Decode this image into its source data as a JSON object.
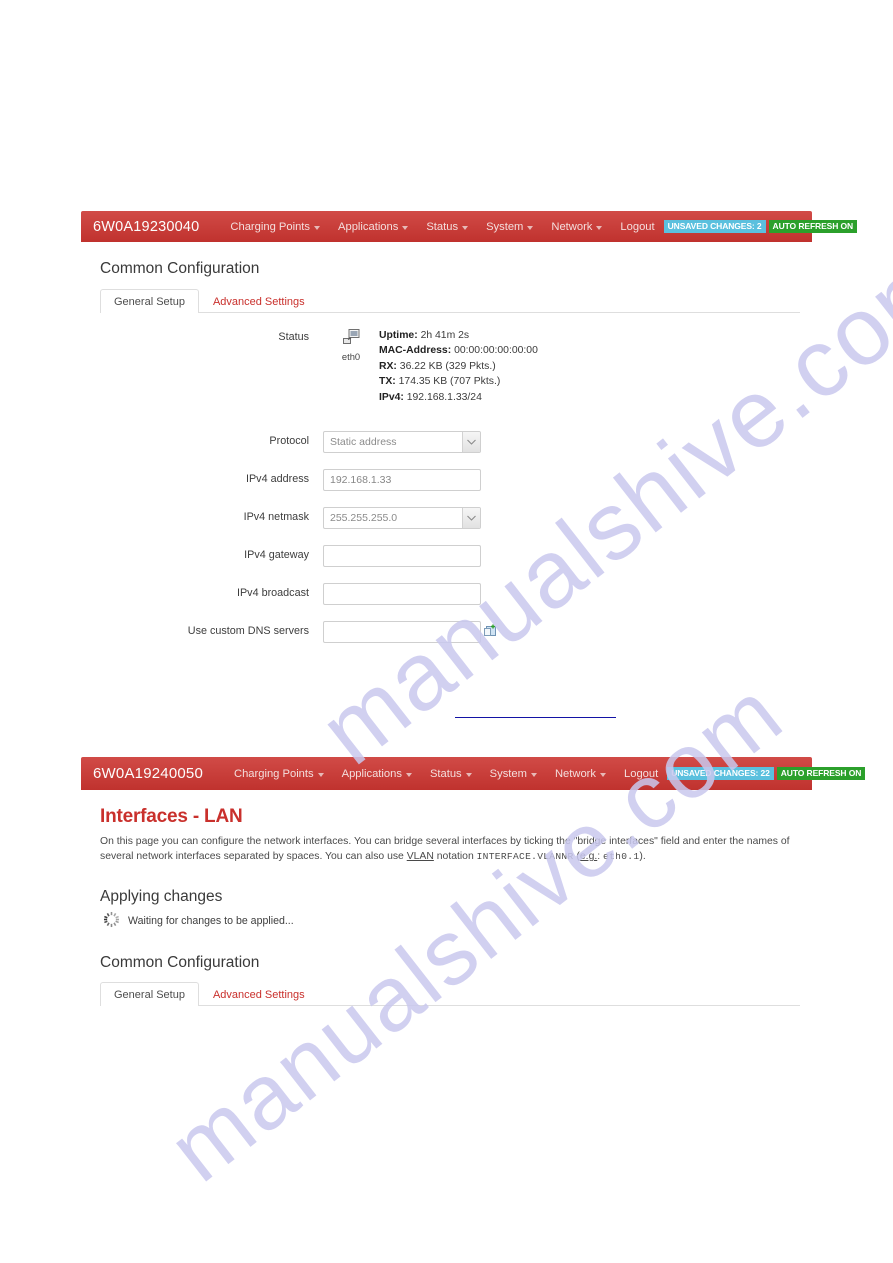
{
  "watermark": {
    "text": "manualshive.com"
  },
  "shot_top": {
    "navbar": {
      "brand": "6W0A19230040",
      "items": [
        {
          "label": "Charging Points",
          "caret": true
        },
        {
          "label": "Applications",
          "caret": true
        },
        {
          "label": "Status",
          "caret": true
        },
        {
          "label": "System",
          "caret": true
        },
        {
          "label": "Network",
          "caret": true
        },
        {
          "label": "Logout",
          "caret": false
        }
      ],
      "badges": {
        "unsaved_changes": "UNSAVED CHANGES: 2",
        "auto_refresh": "AUTO REFRESH ON"
      },
      "colors": {
        "navbar_top": "#d14b47",
        "navbar_bottom": "#c0322e",
        "badge_changes": "#5bc0de",
        "badge_refresh": "#2ba02b"
      }
    },
    "section_title": "Common Configuration",
    "tabs": [
      {
        "label": "General Setup",
        "active": true
      },
      {
        "label": "Advanced Settings",
        "active": false
      }
    ],
    "form": {
      "status": {
        "label": "Status",
        "interface_name": "eth0",
        "lines": [
          {
            "key": "Uptime:",
            "value": "2h 41m 2s"
          },
          {
            "key": "MAC-Address:",
            "value": "00:00:00:00:00:00"
          },
          {
            "key": "RX:",
            "value": "36.22 KB (329 Pkts.)"
          },
          {
            "key": "TX:",
            "value": "174.35 KB (707 Pkts.)"
          },
          {
            "key": "IPv4:",
            "value": "192.168.1.33/24"
          }
        ]
      },
      "protocol": {
        "label": "Protocol",
        "value": "Static address"
      },
      "ipv4_address": {
        "label": "IPv4 address",
        "value": "192.168.1.33",
        "placeholder": ""
      },
      "ipv4_netmask": {
        "label": "IPv4 netmask",
        "value": "255.255.255.0"
      },
      "ipv4_gateway": {
        "label": "IPv4 gateway",
        "value": "",
        "placeholder": ""
      },
      "ipv4_broadcast": {
        "label": "IPv4 broadcast",
        "value": "",
        "placeholder": ""
      },
      "custom_dns": {
        "label": "Use custom DNS servers",
        "value": "",
        "placeholder": ""
      }
    }
  },
  "shot_bottom": {
    "navbar": {
      "brand": "6W0A19240050",
      "items": [
        {
          "label": "Charging Points",
          "caret": true
        },
        {
          "label": "Applications",
          "caret": true
        },
        {
          "label": "Status",
          "caret": true
        },
        {
          "label": "System",
          "caret": true
        },
        {
          "label": "Network",
          "caret": true
        },
        {
          "label": "Logout",
          "caret": false
        }
      ],
      "badges": {
        "unsaved_changes": "UNSAVED CHANGES: 22",
        "auto_refresh": "AUTO REFRESH ON"
      }
    },
    "page_title": "Interfaces - LAN",
    "lead_part1": "On this page you can configure the network interfaces. You can bridge several interfaces by ticking the \"bridge interfaces\" field and enter the names of several network interfaces separated by spaces. You can also use ",
    "lead_vlan": "VLAN",
    "lead_part2": " notation ",
    "lead_mono1": "INTERFACE.VLANNR",
    "lead_part3": " (",
    "lead_eg": "e.g.",
    "lead_part4": ": ",
    "lead_mono2": "eth0.1",
    "lead_part5": ").",
    "applying_title": "Applying changes",
    "applying_text": "Waiting for changes to be applied...",
    "section_title": "Common Configuration",
    "tabs": [
      {
        "label": "General Setup",
        "active": true
      },
      {
        "label": "Advanced Settings",
        "active": false
      }
    ]
  }
}
